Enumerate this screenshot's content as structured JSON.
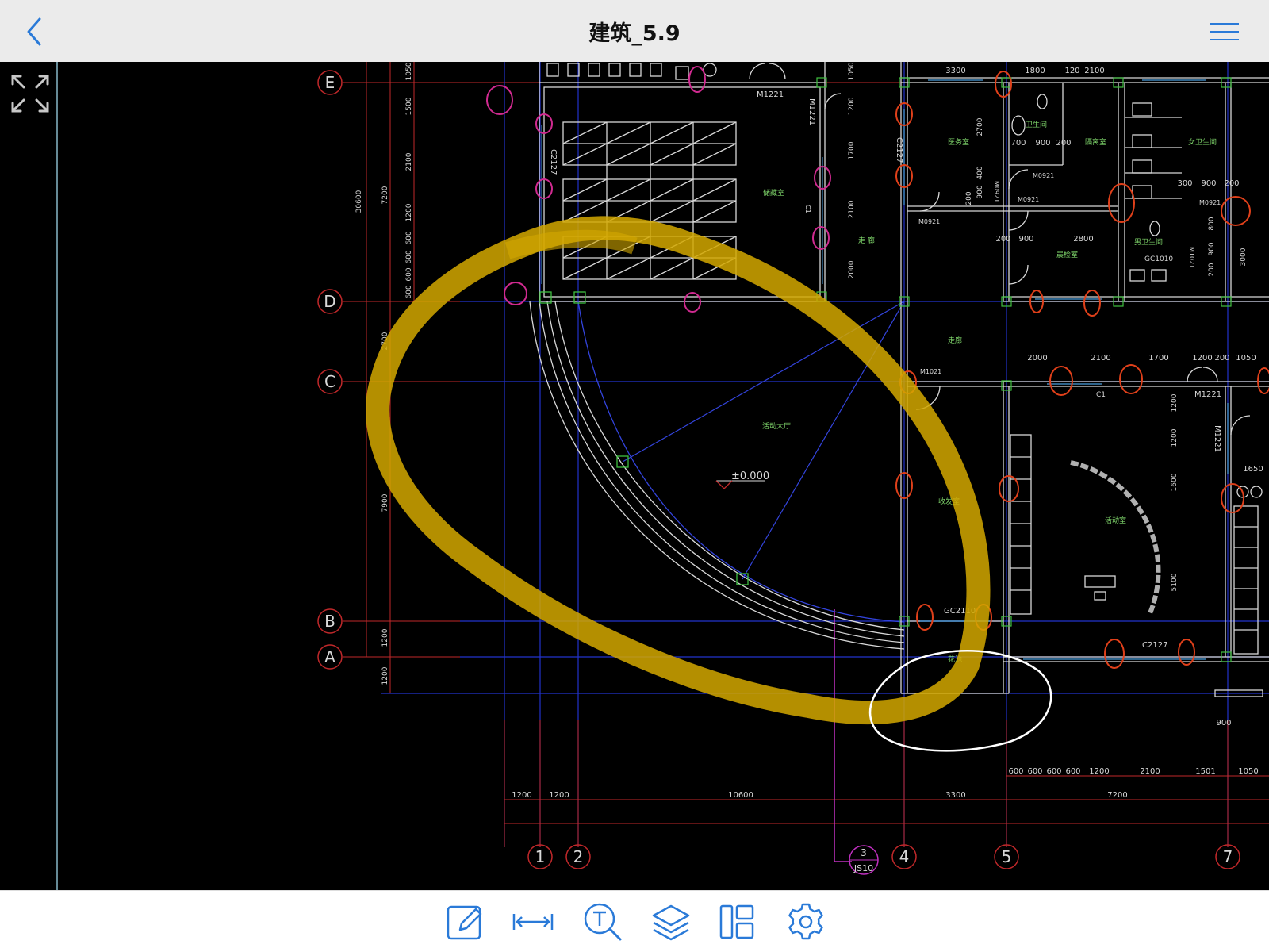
{
  "header": {
    "title": "建筑_5.9",
    "back_icon": "chevron-left-icon",
    "menu_icon": "hamburger-menu-icon"
  },
  "colors": {
    "accent": "#2a7ad8",
    "grid_red": "#c0282a",
    "axis_blue": "#2233cc",
    "wall": "#d8d8d8",
    "text_green": "#7ed46a",
    "highlighter_yellow": "#d4a800",
    "revision_red": "#e0401a",
    "revision_magenta": "#d02a90"
  },
  "drawing": {
    "grid_rows": [
      "E",
      "D",
      "C",
      "B",
      "A"
    ],
    "grid_cols": [
      "1",
      "2",
      "4",
      "5",
      "7"
    ],
    "section_marker": {
      "top": "3",
      "bottom": "JS10"
    },
    "level_mark": "±0.000",
    "rooms": {
      "r1": "活动大厅",
      "r2": "医务室",
      "r3": "卫生间",
      "r4": "隔离室",
      "r5": "女卫生间",
      "r6": "男卫生间",
      "r7": "晨检室",
      "r8": "活动室",
      "r9": "走廊",
      "r10": "走 廊",
      "r11": "储藏室",
      "r12": "收发室",
      "r13": "花池"
    },
    "tags": {
      "m1221a": "M1221",
      "m1221b": "M1221",
      "m1221c": "M1221",
      "m1221d": "M1221",
      "c2127a": "C2127",
      "c2127b": "C2127",
      "c2127c": "C2127",
      "m0921a": "M0921",
      "m0921b": "M0921",
      "m0921c": "M0921",
      "m0921d": "M0921",
      "m0921e": "M0921",
      "m1021": "M1021",
      "gc1010": "GC1010",
      "gc2110": "GC2110",
      "c1a": "C1",
      "c1b": "C1",
      "m1021b": "M1021"
    },
    "dims": {
      "d3300": "3300",
      "d1800": "1800",
      "d120": "120",
      "d2100a": "2100",
      "d700": "700",
      "d900a": "900",
      "d200a": "200",
      "d300": "300",
      "d900b": "900",
      "d200b": "200",
      "d200c": "200",
      "d900c": "900",
      "d2800": "2800",
      "d2000": "2000",
      "d2100b": "2100",
      "d1700": "1700",
      "d1200a": "1200",
      "d200d": "200",
      "d1050": "1050",
      "d1650": "1650",
      "d900d": "900",
      "b600a": "600",
      "b600b": "600",
      "b600c": "600",
      "b600d": "600",
      "b1200": "1200",
      "b2100": "2100",
      "b1501": "1501",
      "b1050": "1050",
      "c1200a": "1200",
      "c1200b": "1200",
      "c10600": "10600",
      "c3300": "3300",
      "c7200": "7200",
      "v30600": "30600",
      "v7200": "7200",
      "v1050": "1050",
      "v1500": "1500",
      "v2100": "2100",
      "v1200": "1200",
      "v600a": "600",
      "v600b": "600",
      "v600c": "600",
      "v600d": "600",
      "v2700": "2700",
      "v7900": "7900",
      "v1200b": "1200",
      "v1200c": "1200",
      "w2700": "2700",
      "w900": "900",
      "w400": "400",
      "w200": "200",
      "w1050": "1050",
      "w1200": "1200",
      "w1700": "1700",
      "w2100": "2100",
      "w2000": "2000",
      "e3000": "3000",
      "e200": "200",
      "e900": "900",
      "e800": "800",
      "f1200a": "1200",
      "f1200b": "1200",
      "f1600": "1600",
      "f5100": "5100"
    }
  },
  "toolbar": {
    "tools": [
      {
        "name": "annotate-tool",
        "icon": "pencil-square-icon"
      },
      {
        "name": "measure-tool",
        "icon": "dimension-arrow-icon"
      },
      {
        "name": "text-search-tool",
        "icon": "text-search-icon"
      },
      {
        "name": "layers-tool",
        "icon": "layers-icon"
      },
      {
        "name": "layout-tool",
        "icon": "layout-panels-icon"
      },
      {
        "name": "settings-tool",
        "icon": "gear-icon"
      }
    ]
  },
  "expand_icon": "expand-arrows-icon"
}
